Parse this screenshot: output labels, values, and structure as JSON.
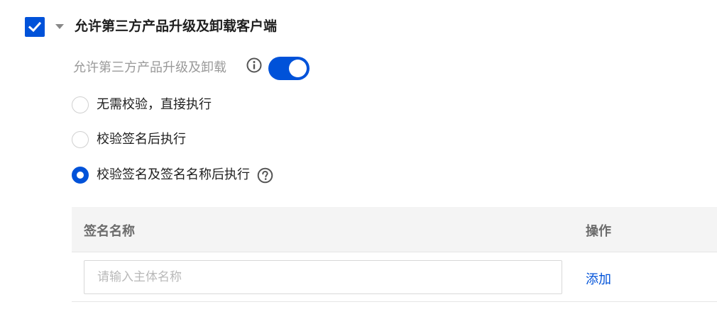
{
  "section": {
    "title": "允许第三方产品升级及卸载客户端",
    "checked": true
  },
  "toggle": {
    "label": "允许第三方产品升级及卸载",
    "enabled": true
  },
  "radios": [
    {
      "label": "无需校验，直接执行",
      "checked": false
    },
    {
      "label": "校验签名后执行",
      "checked": false
    },
    {
      "label": "校验签名及签名名称后执行",
      "checked": true
    }
  ],
  "table": {
    "columns": [
      "签名名称",
      "操作"
    ],
    "input_placeholder": "请输入主体名称",
    "action_label": "添加"
  },
  "colors": {
    "primary": "#0052d9"
  },
  "icons": {
    "checkbox": "check-icon",
    "expand": "caret-down-icon",
    "info": "info-icon",
    "help": "question-circle-icon"
  }
}
